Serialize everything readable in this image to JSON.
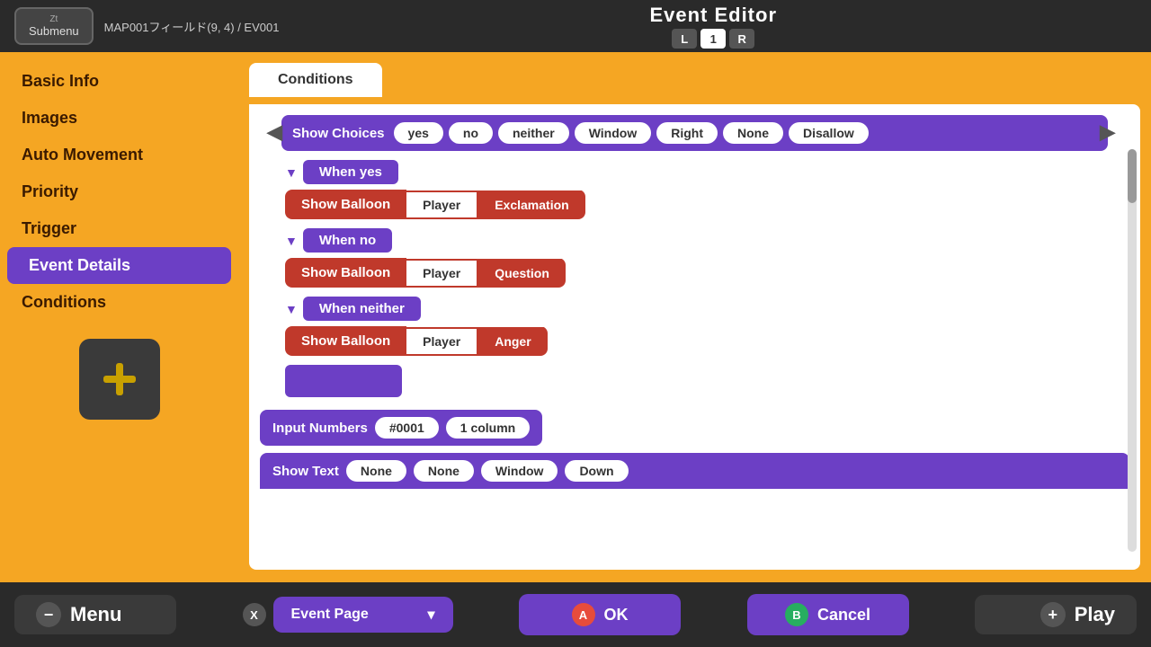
{
  "topbar": {
    "submenu_zt": "Zt",
    "submenu_label": "Submenu",
    "breadcrumb": "MAP001フィールド(9, 4) / EV001",
    "title": "Event Editor",
    "page_l": "L",
    "page_num": "1",
    "page_r": "R"
  },
  "sidebar": {
    "items": [
      {
        "label": "Basic Info",
        "active": false
      },
      {
        "label": "Images",
        "active": false
      },
      {
        "label": "Auto Movement",
        "active": false
      },
      {
        "label": "Priority",
        "active": false
      },
      {
        "label": "Trigger",
        "active": false
      },
      {
        "label": "Event Details",
        "active": true
      },
      {
        "label": "Conditions",
        "active": false
      }
    ]
  },
  "tabs": [
    {
      "label": "Conditions",
      "active": false
    }
  ],
  "editor": {
    "show_choices": {
      "label": "Show Choices",
      "buttons": [
        "yes",
        "no",
        "neither",
        "Window",
        "Right",
        "None",
        "Disallow"
      ]
    },
    "when_yes": {
      "label": "When yes",
      "action_label": "Show Balloon",
      "param1": "Player",
      "param2": "Exclamation"
    },
    "when_no": {
      "label": "When no",
      "action_label": "Show Balloon",
      "param1": "Player",
      "param2": "Question"
    },
    "when_neither": {
      "label": "When neither",
      "action_label": "Show Balloon",
      "param1": "Player",
      "param2": "Anger"
    },
    "input_numbers": {
      "label": "Input Numbers",
      "param1": "#0001",
      "param2": "1 column"
    },
    "show_text": {
      "label": "Show Text",
      "params": [
        "None",
        "None",
        "Window",
        "Down"
      ]
    }
  },
  "bottom_bar": {
    "minus_symbol": "−",
    "menu_label": "Menu",
    "x_label": "X",
    "event_page_label": "Event Page",
    "chevron_down": "▾",
    "a_label": "A",
    "ok_label": "OK",
    "b_label": "B",
    "cancel_label": "Cancel",
    "plus_symbol": "+",
    "play_label": "Play"
  }
}
